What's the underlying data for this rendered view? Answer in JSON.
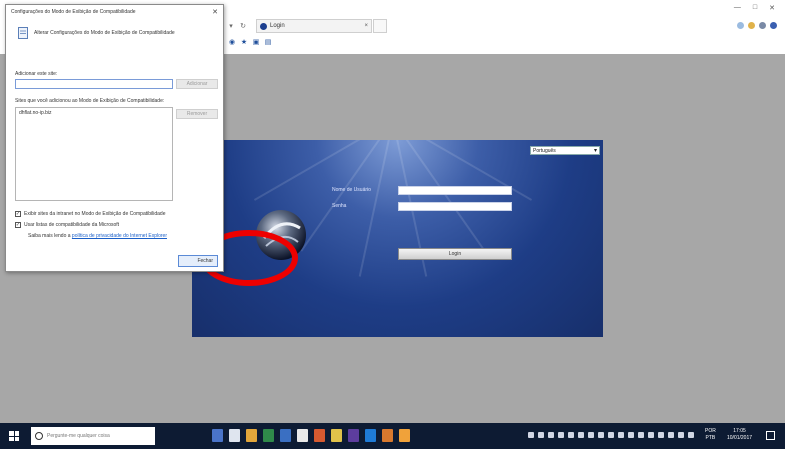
{
  "browser": {
    "tab_title": "Login",
    "tab_close": "×"
  },
  "dialog": {
    "title": "Configurações do Modo de Exibição de Compatibilidade",
    "heading": "Alterar Configurações do Modo de Exibição de Compatibilidade",
    "add_label": "Adicionar este site:",
    "add_button": "Adicionar",
    "list_label": "Sites que você adicionou ao Modo de Exibição de Compatibilidade:",
    "remove_button": "Remover",
    "site_list": [
      "dhflat.no-ip.biz"
    ],
    "checkbox_intranet": "Exibir sites da intranet no Modo de Exibição de Compatibilidade",
    "checkbox_microsoft": "Usar listas de compatibilidade da Microsoft",
    "info_text": "Saiba mais lendo a",
    "info_link": "política de privacidade do Internet Explorer",
    "close_button": "Fechar"
  },
  "login": {
    "language": "Português",
    "username_label": "Nome de Usuário",
    "password_label": "Senha",
    "login_button": "Login"
  },
  "taskbar": {
    "search_placeholder": "Pergunte-me qualquer coisa",
    "lang_line1": "POR",
    "lang_line2": "PTB",
    "time": "17:05",
    "date": "10/01/2017"
  },
  "colors": {
    "accent": "#1e3d86",
    "annotation": "#ee0000",
    "taskbar": "#0d1b33",
    "content_bg": "#a7a7a7"
  }
}
